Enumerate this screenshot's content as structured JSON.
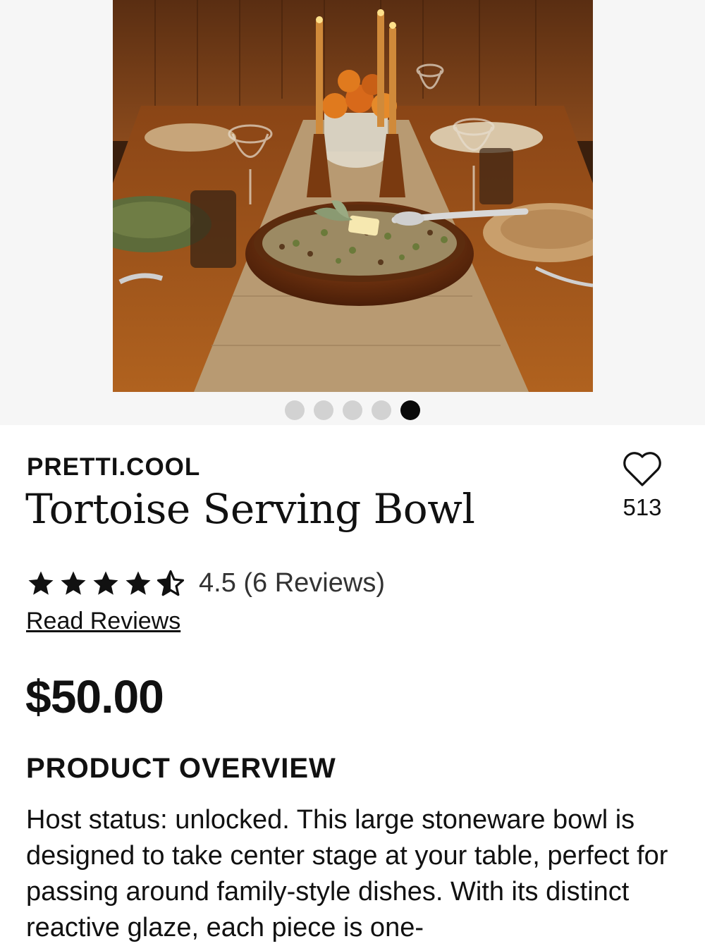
{
  "gallery": {
    "image_alt": "Tortoise Serving Bowl on a set dinner table",
    "dot_count": 5,
    "active_index": 4
  },
  "product": {
    "brand": "PRETTI.COOL",
    "title": "Tortoise Serving Bowl",
    "favorites_count": "513",
    "rating_value": 4.5,
    "rating_max": 5,
    "rating_text": "4.5 (6 Reviews)",
    "read_reviews_label": "Read Reviews",
    "price": "$50.00"
  },
  "overview": {
    "heading": "PRODUCT OVERVIEW",
    "text": "Host status: unlocked. This large stoneware bowl is designed to take center stage at your table, perfect for passing around family-style dishes. With its distinct reactive glaze, each piece is one-"
  },
  "colors": {
    "active_dot": "#0a0a0a",
    "inactive_dot": "#d2d2d2",
    "text": "#111111"
  }
}
